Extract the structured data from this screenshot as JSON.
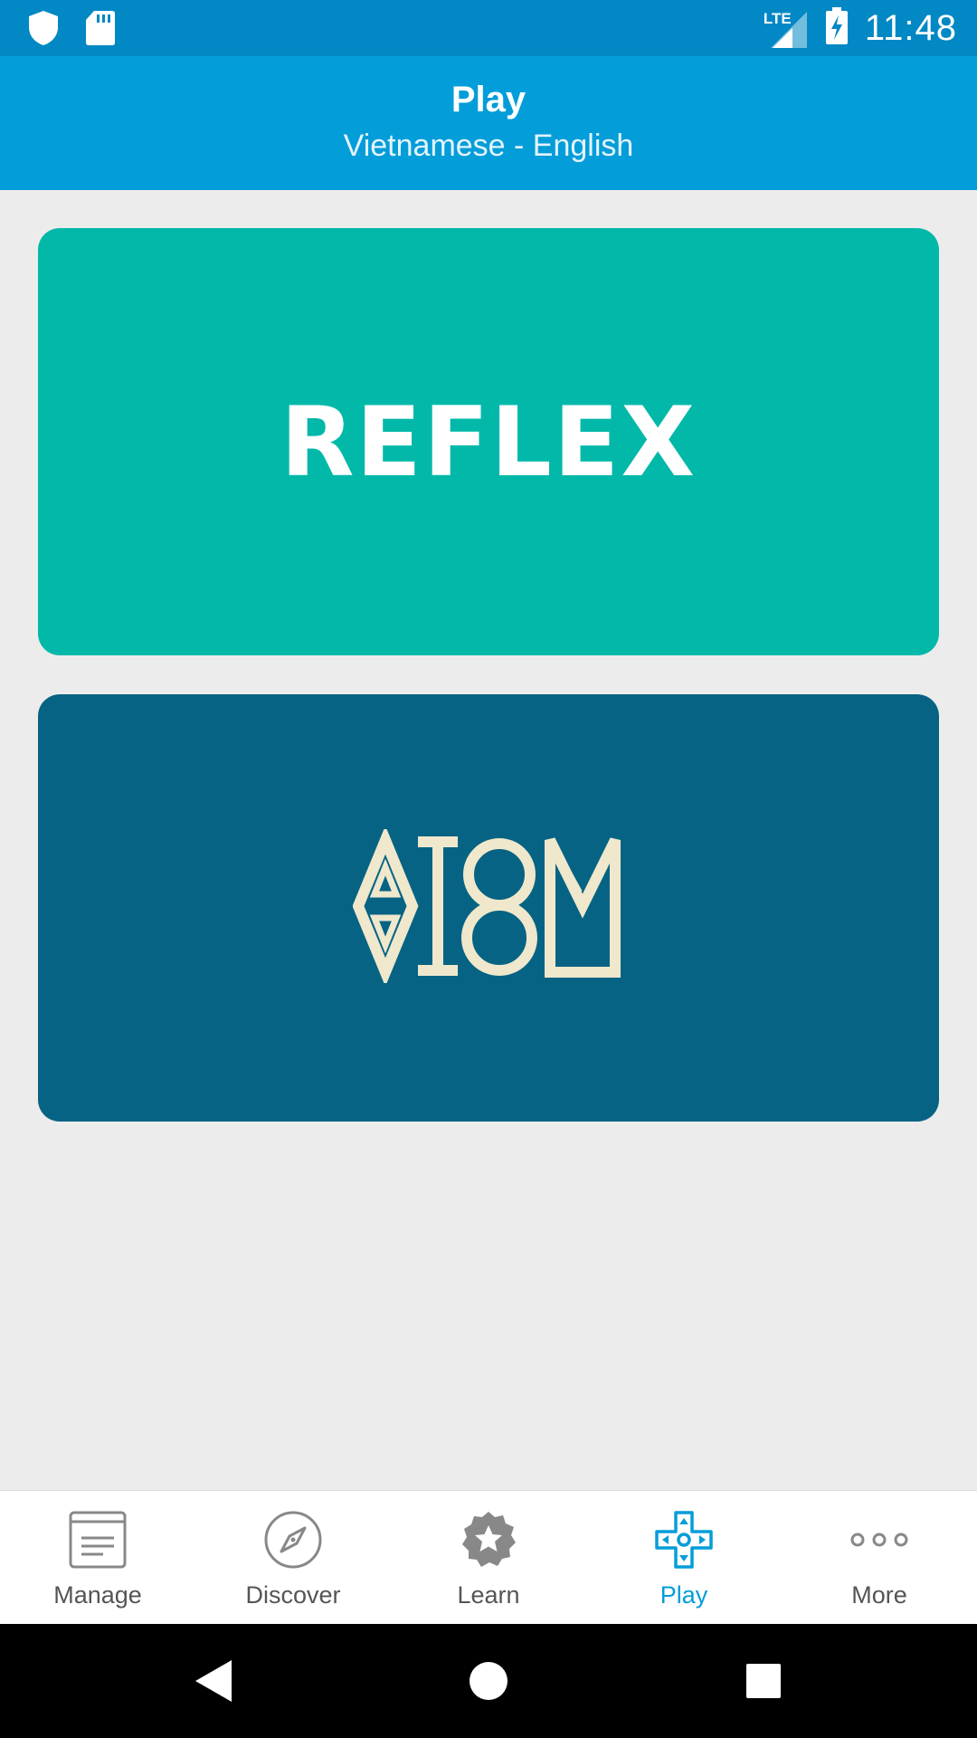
{
  "status_bar": {
    "time": "11:48",
    "network_label": "LTE",
    "icons": [
      "shield-icon",
      "sd-card-icon",
      "signal-icon",
      "battery-charging-icon"
    ]
  },
  "app_bar": {
    "title": "Play",
    "subtitle": "Vietnamese - English"
  },
  "cards": {
    "reflex": {
      "title": "REFLEX",
      "color": "#02b8a9"
    },
    "atom": {
      "logo_text": "ATOM",
      "color": "#066384",
      "logo_color": "#efe8cc"
    }
  },
  "bottom_nav": {
    "items": [
      {
        "label": "Manage",
        "icon": "document-icon",
        "active": false
      },
      {
        "label": "Discover",
        "icon": "compass-icon",
        "active": false
      },
      {
        "label": "Learn",
        "icon": "badge-star-icon",
        "active": false
      },
      {
        "label": "Play",
        "icon": "gamepad-icon",
        "active": true
      },
      {
        "label": "More",
        "icon": "more-icon",
        "active": false
      }
    ],
    "active_color": "#039dd9"
  },
  "system_nav": {
    "icons": [
      "back-icon",
      "home-icon",
      "recents-icon"
    ]
  }
}
